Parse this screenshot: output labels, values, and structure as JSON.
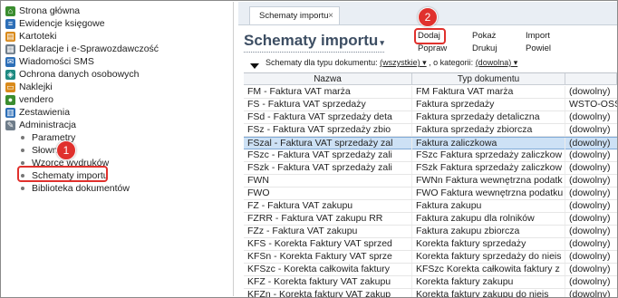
{
  "sidebar": {
    "items": [
      {
        "label": "Strona główna",
        "icon": "home-icon"
      },
      {
        "label": "Ewidencje księgowe",
        "icon": "ledger-icon"
      },
      {
        "label": "Kartoteki",
        "icon": "cards-icon"
      },
      {
        "label": "Deklaracje i e-Sprawozdawczość",
        "icon": "declaration-icon"
      },
      {
        "label": "Wiadomości SMS",
        "icon": "sms-icon"
      },
      {
        "label": "Ochrona danych osobowych",
        "icon": "shield-icon"
      },
      {
        "label": "Naklejki",
        "icon": "label-icon"
      },
      {
        "label": "vendero",
        "icon": "vendero-icon"
      },
      {
        "label": "Zestawienia",
        "icon": "report-icon"
      },
      {
        "label": "Administracja",
        "icon": "admin-icon"
      }
    ],
    "admin_children": [
      {
        "label": "Parametry"
      },
      {
        "label": "Słowniki"
      },
      {
        "label": "Wzorce wydruków"
      },
      {
        "label": "Schematy importu"
      },
      {
        "label": "Biblioteka dokumentów"
      }
    ],
    "marker_1": "1"
  },
  "tab": {
    "label": "Schematy importu",
    "close": "×"
  },
  "header": {
    "title": "Schematy importu",
    "title_caret": "▾"
  },
  "actions": {
    "dodaj": "Dodaj",
    "popraw": "Popraw",
    "pokaz": "Pokaż",
    "drukuj": "Drukuj",
    "import": "Import",
    "powiel": "Powiel",
    "marker_2": "2"
  },
  "filters": {
    "prefix": "Schematy dla typu dokumentu:",
    "type_value": "(wszystkie) ▾",
    "middle": ", o kategorii:",
    "category_value": "(dowolna) ▾"
  },
  "grid": {
    "columns": [
      "Nazwa",
      "Typ dokumentu",
      ""
    ],
    "rows": [
      [
        "FM - Faktura VAT marża",
        "FM Faktura VAT marża",
        "(dowolny)"
      ],
      [
        "FS - Faktura VAT sprzedaży",
        "Faktura sprzedaży",
        "WSTO-OSS"
      ],
      [
        "FSd - Faktura VAT sprzedaży deta",
        "Faktura sprzedaży detaliczna",
        "(dowolny)"
      ],
      [
        "FSz - Faktura VAT sprzedaży zbio",
        "Faktura sprzedaży zbiorcza",
        "(dowolny)"
      ],
      [
        "FSzal - Faktura VAT sprzedaży zal",
        "Faktura zaliczkowa",
        "(dowolny)"
      ],
      [
        "FSzc - Faktura VAT sprzedaży zali",
        "FSzc Faktura sprzedaży zaliczkow",
        "(dowolny)"
      ],
      [
        "FSzk - Faktura VAT sprzedaży zali",
        "FSzk Faktura sprzedaży zaliczkow",
        "(dowolny)"
      ],
      [
        "FWN",
        "FWNn Faktura wewnętrzna podatk",
        "(dowolny)"
      ],
      [
        "FWO",
        "FWO Faktura wewnętrzna podatku",
        "(dowolny)"
      ],
      [
        "FZ - Faktura VAT zakupu",
        "Faktura zakupu",
        "(dowolny)"
      ],
      [
        "FZRR - Faktura VAT zakupu RR",
        "Faktura zakupu dla rolników",
        "(dowolny)"
      ],
      [
        "FZz - Faktura VAT zakupu",
        "Faktura zakupu zbiorcza",
        "(dowolny)"
      ],
      [
        "KFS - Korekta Faktury VAT sprzed",
        "Korekta faktury sprzedaży",
        "(dowolny)"
      ],
      [
        "KFSn - Korekta Faktury VAT sprze",
        "Korekta faktury sprzedaży do nieis",
        "(dowolny)"
      ],
      [
        "KFSzc - Korekta całkowita faktury",
        "KFSzc Korekta całkowita faktury z",
        "(dowolny)"
      ],
      [
        "KFZ - Korekta faktury VAT zakupu",
        "Korekta faktury zakupu",
        "(dowolny)"
      ],
      [
        "KFZn - Korekta faktury VAT zakup",
        "Korekta faktury zakupu do nieis",
        "(dowolny)"
      ]
    ],
    "selected_row_index": 4
  },
  "colors": {
    "accent_red": "#e0312d",
    "selected_row": "#cde1f5",
    "title": "#3d4e63"
  }
}
